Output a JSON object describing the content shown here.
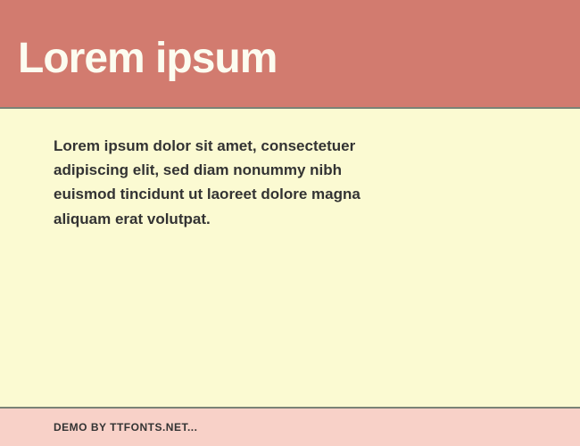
{
  "header": {
    "title": "Lorem ipsum"
  },
  "body": {
    "text": "Lorem ipsum dolor sit amet, consectetuer adipiscing elit, sed diam nonummy nibh euismod tincidunt ut laoreet dolore magna aliquam erat volutpat."
  },
  "footer": {
    "text": "DEMO BY TTFONTS.NET..."
  }
}
